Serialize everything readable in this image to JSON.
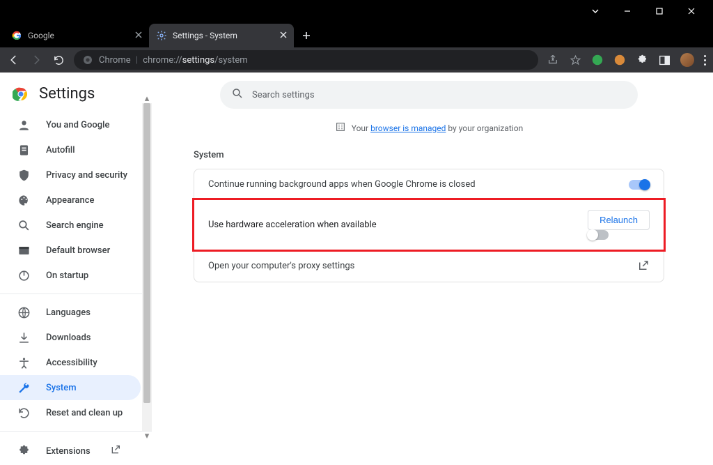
{
  "window": {
    "titlebar_buttons": [
      "chevron-down",
      "minimize",
      "maximize",
      "close"
    ]
  },
  "tabs": [
    {
      "title": "Google",
      "active": false
    },
    {
      "title": "Settings - System",
      "active": true
    }
  ],
  "addressbar": {
    "prefix": "Chrome",
    "url_plain1": "chrome://",
    "url_bold": "settings",
    "url_plain2": "/system"
  },
  "settings": {
    "title": "Settings",
    "search_placeholder": "Search settings",
    "managed_prefix": "Your ",
    "managed_link": "browser is managed",
    "managed_suffix": " by your organization",
    "section": "System",
    "rows": {
      "bg_apps": "Continue running background apps when Google Chrome is closed",
      "hw_accel": "Use hardware acceleration when available",
      "proxy": "Open your computer's proxy settings"
    },
    "relaunch": "Relaunch",
    "toggles": {
      "bg_apps": true,
      "hw_accel": false
    }
  },
  "sidebar": {
    "items": [
      {
        "key": "you",
        "label": "You and Google"
      },
      {
        "key": "autofill",
        "label": "Autofill"
      },
      {
        "key": "privacy",
        "label": "Privacy and security"
      },
      {
        "key": "appearance",
        "label": "Appearance"
      },
      {
        "key": "search",
        "label": "Search engine"
      },
      {
        "key": "default",
        "label": "Default browser"
      },
      {
        "key": "startup",
        "label": "On startup"
      },
      {
        "key": "languages",
        "label": "Languages"
      },
      {
        "key": "downloads",
        "label": "Downloads"
      },
      {
        "key": "accessibility",
        "label": "Accessibility"
      },
      {
        "key": "system",
        "label": "System"
      },
      {
        "key": "reset",
        "label": "Reset and clean up"
      }
    ],
    "extensions": "Extensions"
  }
}
